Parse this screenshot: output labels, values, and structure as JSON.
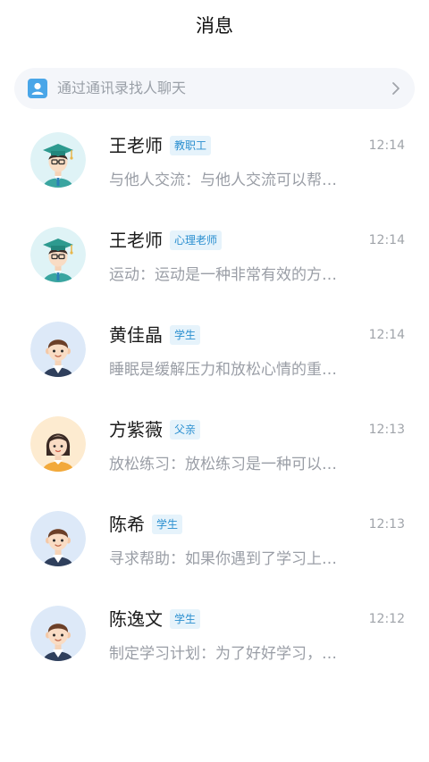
{
  "header": {
    "title": "消息"
  },
  "search": {
    "label": "通过通讯录找人聊天"
  },
  "icons": {
    "contact": "contact-card-icon",
    "chevron": "chevron-right-icon"
  },
  "colors": {
    "badge_text": "#2a8fd0",
    "badge_bg": "#e6f3fb",
    "search_bg": "#f4f6fa",
    "contact_icon": "#4aa6e8"
  },
  "conversations": [
    {
      "name": "王老师",
      "badge": "教职工",
      "time": "12:14",
      "preview": "与他人交流：与他人交流可以帮…",
      "avatar": "teacher-avatar"
    },
    {
      "name": "王老师",
      "badge": "心理老师",
      "time": "12:14",
      "preview": "运动：运动是一种非常有效的方…",
      "avatar": "teacher-avatar"
    },
    {
      "name": "黄佳晶",
      "badge": "学生",
      "time": "12:14",
      "preview": "睡眠是缓解压力和放松心情的重…",
      "avatar": "student-avatar"
    },
    {
      "name": "方紫薇",
      "badge": "父亲",
      "time": "12:13",
      "preview": "放松练习：放松练习是一种可以…",
      "avatar": "parent-avatar"
    },
    {
      "name": "陈希",
      "badge": "学生",
      "time": "12:13",
      "preview": "寻求帮助：如果你遇到了学习上…",
      "avatar": "student-avatar"
    },
    {
      "name": "陈逸文",
      "badge": "学生",
      "time": "12:12",
      "preview": "制定学习计划：为了好好学习，…",
      "avatar": "student-avatar"
    }
  ]
}
